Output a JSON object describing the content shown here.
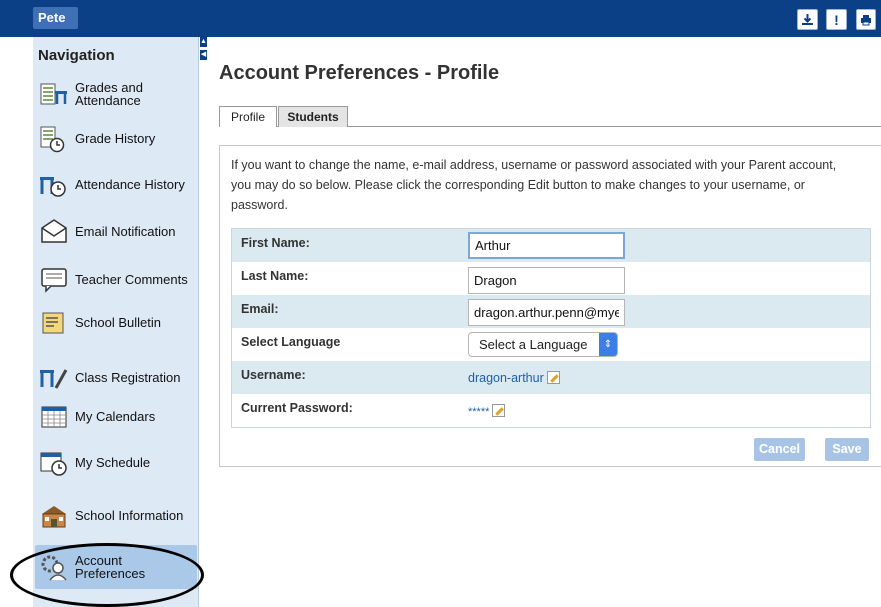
{
  "topbar": {
    "user": "Pete",
    "icons": [
      "download-icon",
      "alert-icon",
      "print-icon"
    ],
    "alert_glyph": "!"
  },
  "sidebar": {
    "title": "Navigation",
    "items": [
      {
        "label": "Grades and Attendance",
        "icon": "grades-attendance-icon"
      },
      {
        "label": "Grade History",
        "icon": "grade-history-icon"
      },
      {
        "label": "Attendance History",
        "icon": "attendance-history-icon"
      },
      {
        "label": "Email Notification",
        "icon": "email-icon"
      },
      {
        "label": "Teacher Comments",
        "icon": "comments-icon"
      },
      {
        "label": "School Bulletin",
        "icon": "bulletin-icon"
      },
      {
        "label": "Class Registration",
        "icon": "registration-icon"
      },
      {
        "label": "My Calendars",
        "icon": "calendar-icon"
      },
      {
        "label": "My Schedule",
        "icon": "schedule-icon"
      },
      {
        "label": "School Information",
        "icon": "school-icon"
      },
      {
        "label": "Account Preferences",
        "icon": "account-preferences-icon",
        "active": true
      }
    ]
  },
  "main": {
    "title": "Account Preferences - Profile",
    "tabs": [
      {
        "label": "Profile",
        "selected": true
      },
      {
        "label": "Students",
        "selected": false
      }
    ],
    "intro": "If you want to change the name, e-mail address, username or password associated with your Parent account, you may do so below. Please click the corresponding Edit button to make changes to your username, or password.",
    "form": {
      "first_name_label": "First Name:",
      "first_name_value": "Arthur",
      "last_name_label": "Last Name:",
      "last_name_value": "Dragon",
      "email_label": "Email:",
      "email_value": "dragon.arthur.penn@mye",
      "language_label": "Select Language",
      "language_value": "Select a Language",
      "username_label": "Username:",
      "username_value": "dragon-arthur",
      "password_label": "Current Password:",
      "password_value": "*****"
    },
    "buttons": {
      "cancel": "Cancel",
      "save": "Save"
    }
  },
  "colors": {
    "header": "#0b3f86",
    "sidebar": "#dde9f5",
    "row_shade": "#dbe9f1",
    "button": "#a8c4e4"
  }
}
